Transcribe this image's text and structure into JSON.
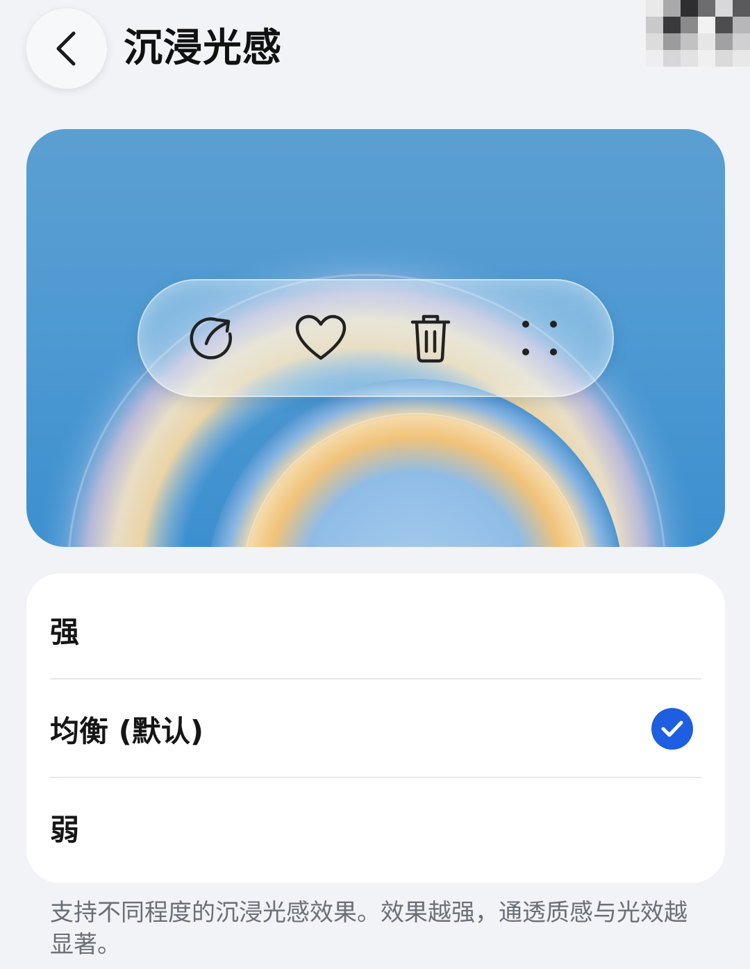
{
  "header": {
    "title": "沉浸光感"
  },
  "preview": {
    "toolbar_icons": [
      "share-icon",
      "heart-icon",
      "trash-icon",
      "more-dots-icon"
    ]
  },
  "options": {
    "items": [
      {
        "label": "强",
        "selected": false
      },
      {
        "label": "均衡 (默认)",
        "selected": true
      },
      {
        "label": "弱",
        "selected": false
      }
    ]
  },
  "description": "支持不同程度的沉浸光感效果。效果越强，通透质感与光效越显著。",
  "colors": {
    "accent": "#1d5fe0",
    "background": "#f1f3f7",
    "card": "#ffffff"
  }
}
